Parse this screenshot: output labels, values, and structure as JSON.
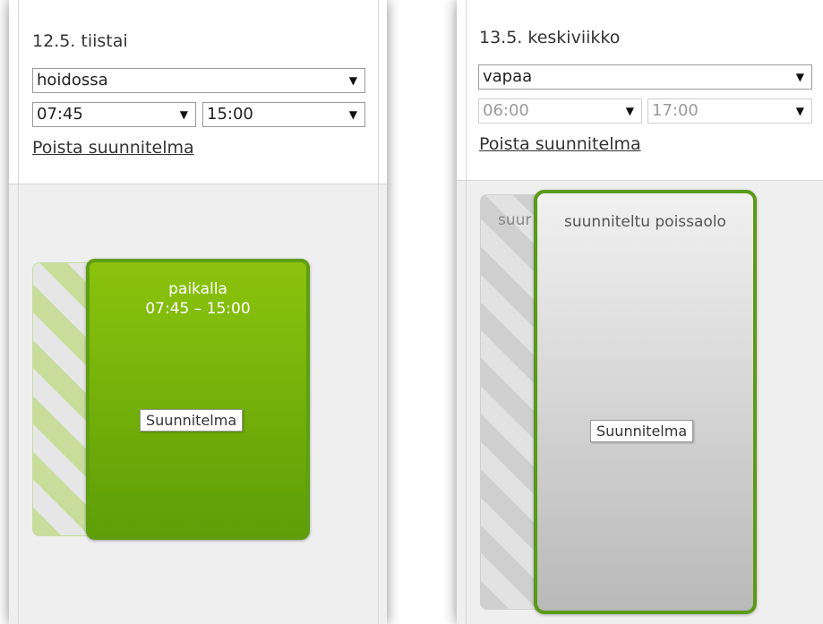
{
  "left_day": {
    "title": "12.5. tiistai",
    "status_select": "hoidossa",
    "start_time": "07:45",
    "end_time": "15:00",
    "remove_link": "Poista suunnitelma",
    "card": {
      "label": "paikalla",
      "time_range": "07:45 – 15:00",
      "badge": "Suunnitelma"
    }
  },
  "right_day": {
    "title": "13.5. keskiviikko",
    "status_select": "vapaa",
    "start_time": "06:00",
    "end_time": "17:00",
    "remove_link": "Poista suunnitelma",
    "ghost_label": "suur",
    "card": {
      "label": "suunniteltu poissaolo",
      "badge": "Suunnitelma"
    }
  },
  "icons": {
    "dropdown": "chevron-down-icon"
  },
  "colors": {
    "present_green": "#7ab40b",
    "card_border_green": "#5f9e13",
    "absence_grey": "#c8c8c8"
  }
}
